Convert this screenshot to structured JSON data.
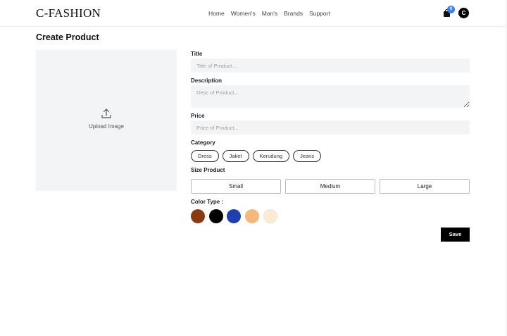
{
  "header": {
    "logo": "C-FASHION",
    "nav": [
      "Home",
      "Women's",
      "Man's",
      "Brands",
      "Support"
    ],
    "cart_count": "0",
    "avatar_initial": "C"
  },
  "page": {
    "title": "Create Product"
  },
  "upload": {
    "label": "Upload Image",
    "icon": "upload-icon"
  },
  "form": {
    "title_label": "Title",
    "title_placeholder": "Title of Product...",
    "description_label": "Description",
    "description_placeholder": "Desc of Product...",
    "price_label": "Price",
    "price_placeholder": "Price of Product...",
    "category_label": "Category",
    "categories": [
      "Dress",
      "Jaket",
      "Kerudung",
      "Jeans"
    ],
    "size_label": "Size Product",
    "sizes": [
      "Small",
      "Medium",
      "Large"
    ],
    "color_label": "Color Type :",
    "colors": [
      "#8B3A0F",
      "#000000",
      "#1E40AF",
      "#F6B87A",
      "#FCEBD3"
    ],
    "save_label": "Save"
  }
}
